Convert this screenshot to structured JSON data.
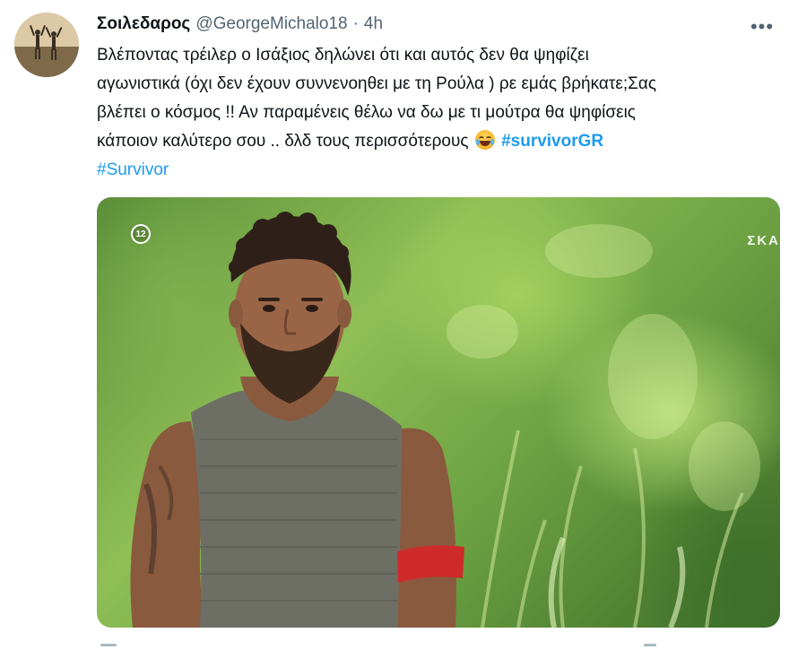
{
  "tweet": {
    "display_name": "Σοιλεδαρος",
    "handle": "@GeorgeMichalo18",
    "separator": "·",
    "timestamp": "4h",
    "more_label": "•••",
    "text_lines": [
      "Βλέποντας τρέιλερ ο Ισάξιος δηλώνει ότι και αυτός δεν θα ψηφίζει",
      "αγωνιστικά (όχι δεν έχουν συννενοηθει με τη Ρούλα ) ρε εμάς βρήκατε;Σας",
      "βλέπει ο κόσμος !! Αν παραμένεις θέλω να δω με τι μούτρα θα ψηφίσεις",
      "κάποιον καλύτερο σου .. δλδ τους περισσότερους"
    ],
    "emoji": "face-with-tears-of-joy",
    "hashtag_1": "#survivorGR",
    "hashtag_2": "#Survivor"
  },
  "media": {
    "rating": "12",
    "channel_logo": "ΣΚΑ"
  },
  "colors": {
    "link": "#1d9bf0",
    "secondary_text": "#536471",
    "primary_text": "#0f1419"
  }
}
